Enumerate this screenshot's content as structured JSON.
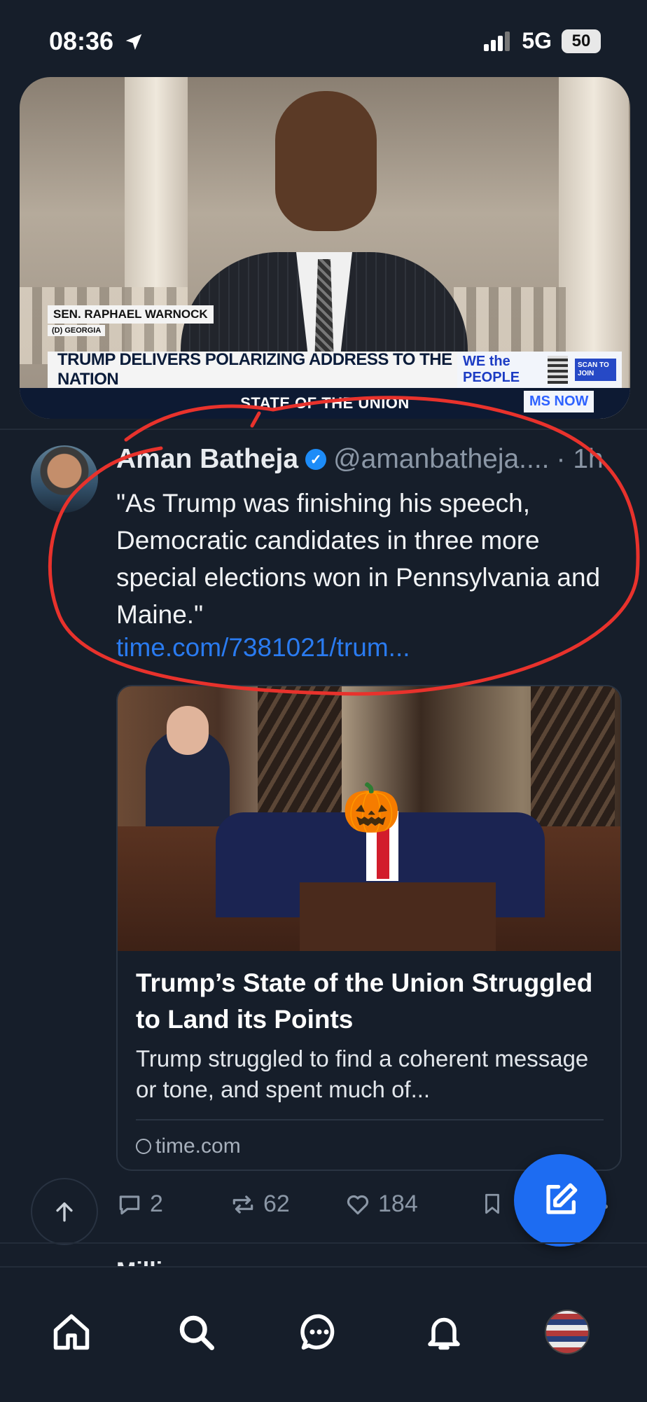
{
  "status_bar": {
    "time": "08:36",
    "network": "5G",
    "battery": "50"
  },
  "video": {
    "name_tag": "SEN. RAPHAEL WARNOCK",
    "name_sub": "(D) GEORGIA",
    "headline": "TRUMP DELIVERS POLARIZING ADDRESS TO THE NATION",
    "program": "STATE OF THE UNION",
    "promo": "WE the PEOPLE",
    "scan_text": "SCAN TO JOIN",
    "network_logo": "MS NOW"
  },
  "post": {
    "author": "Aman Batheja",
    "handle": "@amanbatheja....",
    "time": "· 1h",
    "text": "\"As Trump was finishing his speech, Democratic candidates in three more special elections won in Pennsylvania and Maine.\"",
    "link": "time.com/7381021/trum...",
    "card": {
      "title": "Trump’s State of the Union Struggled to Land its Points",
      "description": "Trump struggled to find a coherent message or tone, and spent much of...",
      "domain": "time.com"
    },
    "counts": {
      "replies": "2",
      "reposts": "62",
      "likes": "184"
    }
  },
  "next_post": {
    "author": "Milli..."
  },
  "icons": {
    "location": "location-arrow-icon",
    "signal": "signal-icon",
    "reply": "reply-icon",
    "repost": "repost-icon",
    "like": "heart-icon",
    "bookmark": "bookmark-icon",
    "compose": "compose-icon",
    "scroll_top": "arrow-up-icon",
    "home": "home-icon",
    "search": "search-icon",
    "messages": "chat-icon",
    "notifications": "bell-icon"
  },
  "colors": {
    "background": "#161e2a",
    "accent": "#1d6cf2",
    "link": "#2a7bf0",
    "annotation": "#e8322c"
  }
}
